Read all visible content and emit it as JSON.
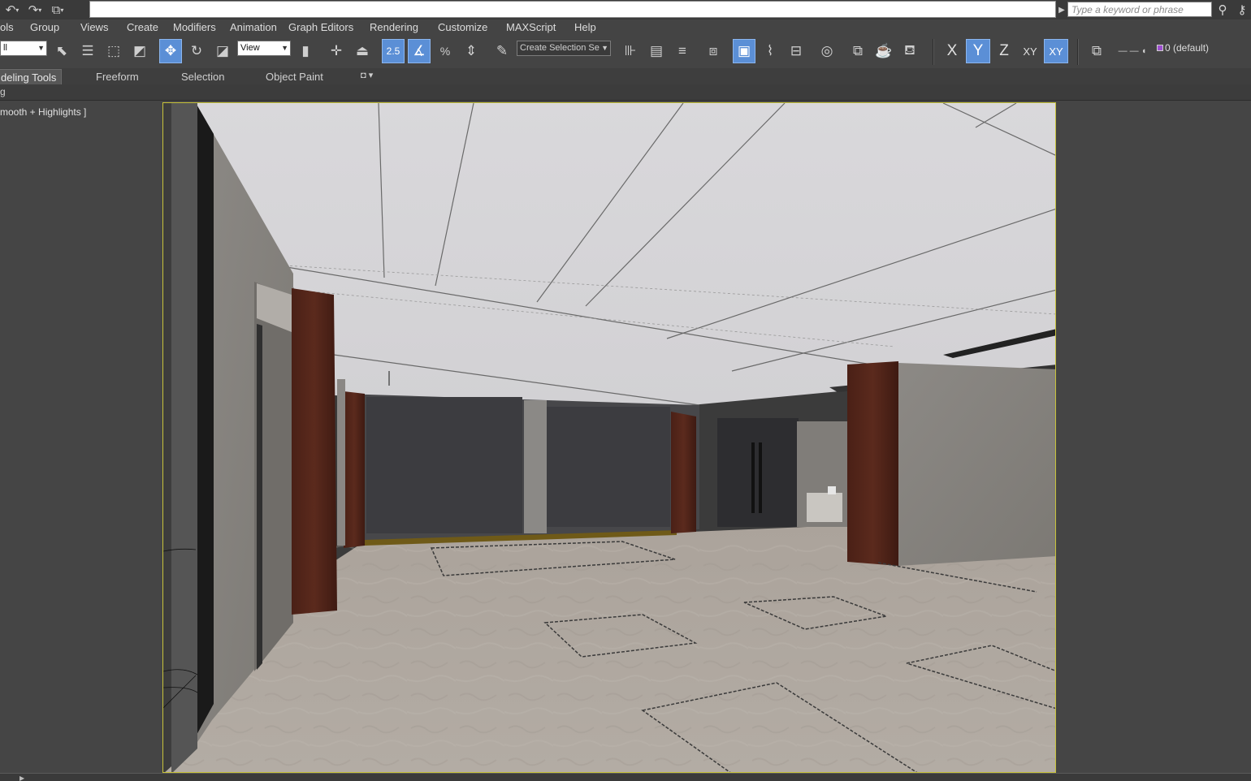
{
  "quick_access": {
    "icons": [
      "undo-icon",
      "redo-icon",
      "project-icon"
    ],
    "title_value": "",
    "search_placeholder": "Type a keyword or phrase"
  },
  "menu": {
    "items": [
      "ols",
      "Group",
      "Views",
      "Create",
      "Modifiers",
      "Animation",
      "Graph Editors",
      "Rendering",
      "Customize",
      "MAXScript",
      "Help"
    ]
  },
  "toolbar": {
    "selection_filter": "ll",
    "reference_coord": "View",
    "snap_value": "2.5",
    "percent_snap": "%",
    "named_selection_placeholder": "Create Selection Se",
    "axis_x": "X",
    "axis_y": "Y",
    "axis_z": "Z",
    "axis_xy": "XY",
    "axis_xy_active": "XY",
    "layer_name": "0 (default)",
    "layer_color": "#9e4fd0",
    "accent_color": "#5b8fd6"
  },
  "ribbon": {
    "tabs": [
      "deling Tools",
      "Freeform",
      "Selection",
      "Object Paint"
    ]
  },
  "subribbon": {
    "label": "g"
  },
  "viewport": {
    "label": "mooth + Highlights ]",
    "frame_color": "#c7c23a"
  }
}
